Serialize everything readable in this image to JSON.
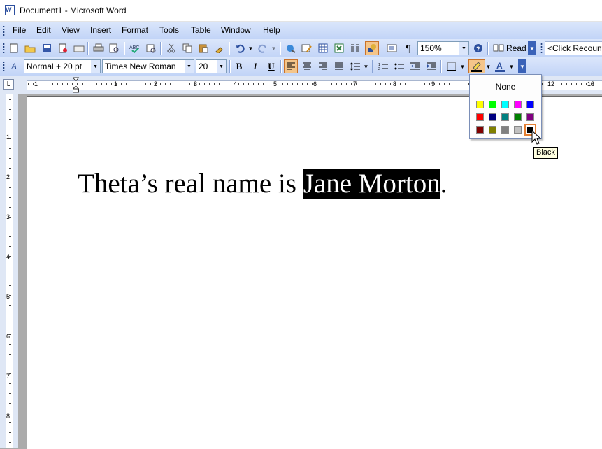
{
  "window": {
    "title": "Document1 - Microsoft Word"
  },
  "menu": [
    "File",
    "Edit",
    "View",
    "Insert",
    "Format",
    "Tools",
    "Table",
    "Window",
    "Help"
  ],
  "standard_toolbar": {
    "zoom": "150%",
    "read_label": "Read",
    "recount": "<Click Recount"
  },
  "formatting_toolbar": {
    "style": "Normal + 20 pt",
    "font": "Times New Roman",
    "size": "20",
    "bold": "B",
    "italic": "I",
    "underline": "U"
  },
  "ruler": {
    "h_numbers": [
      "1",
      "1",
      "2",
      "3",
      "4",
      "5",
      "6",
      "7",
      "8",
      "9",
      "12",
      "13"
    ],
    "v_numbers": [
      "1",
      "2",
      "3",
      "4",
      "5",
      "6",
      "7",
      "8"
    ]
  },
  "document": {
    "text_before": "Theta’s real name is ",
    "highlighted": "Jane Morton",
    "text_after": "."
  },
  "highlight_palette": {
    "none_label": "None",
    "colors": [
      [
        "#ffff00",
        "#00ff00",
        "#00ffff",
        "#ff00ff",
        "#0000ff"
      ],
      [
        "#ff0000",
        "#000080",
        "#008080",
        "#008000",
        "#800080"
      ],
      [
        "#800000",
        "#808000",
        "#808080",
        "#c0c0c0",
        "#000000"
      ]
    ],
    "selected": "#000000",
    "tooltip": "Black"
  },
  "icons": [
    "new-icon",
    "open-icon",
    "save-icon",
    "permission-icon",
    "email-icon",
    "print-icon",
    "print-preview-icon",
    "spelling-icon",
    "research-icon",
    "cut-icon",
    "copy-icon",
    "paste-icon",
    "format-painter-icon",
    "undo-icon",
    "redo-icon",
    "hyperlink-icon",
    "tables-borders-icon",
    "insert-table-icon",
    "insert-excel-icon",
    "columns-icon",
    "drawing-icon",
    "document-map-icon",
    "show-hide-icon",
    "help-icon",
    "read-icon",
    "styles-icon",
    "align-left-icon",
    "center-icon",
    "align-right-icon",
    "justify-icon",
    "line-spacing-icon",
    "numbering-icon",
    "bullets-icon",
    "decrease-indent-icon",
    "increase-indent-icon",
    "border-icon",
    "highlight-icon",
    "font-color-icon"
  ]
}
